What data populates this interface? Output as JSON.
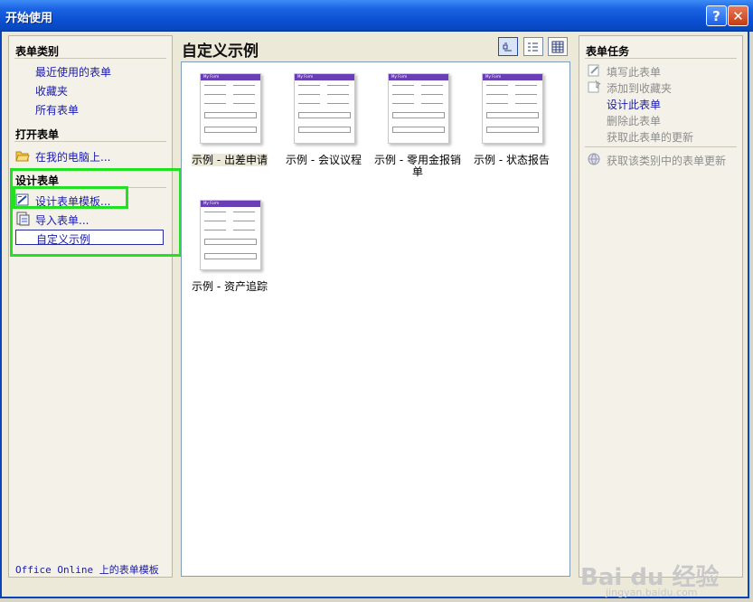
{
  "window": {
    "title": "开始使用",
    "help_label": "?",
    "close_label": "✕"
  },
  "left": {
    "section_categories": "表单类别",
    "categories": [
      {
        "label": "最近使用的表单"
      },
      {
        "label": "收藏夹"
      },
      {
        "label": "所有表单"
      }
    ],
    "section_open": "打开表单",
    "open_on_computer": "在我的电脑上...",
    "section_design": "设计表单",
    "design_template": "设计表单模板...",
    "import_form": "导入表单...",
    "custom_samples": "自定义示例",
    "office_online": "Office Online 上的表单模板"
  },
  "main": {
    "title": "自定义示例",
    "view_buttons": [
      "large-icons",
      "list",
      "details"
    ],
    "samples": [
      {
        "caption": "示例 - 出差申请",
        "selected": true
      },
      {
        "caption": "示例 - 会议议程",
        "selected": false
      },
      {
        "caption": "示例 - 零用金报销单",
        "selected": false
      },
      {
        "caption": "示例 - 状态报告",
        "selected": false
      },
      {
        "caption": "示例 - 资产追踪",
        "selected": false
      }
    ],
    "thumb_header": "My Form"
  },
  "right": {
    "section_tasks": "表单任务",
    "fill_form": "填写此表单",
    "add_favorites": "添加到收藏夹",
    "design_form": "设计此表单",
    "delete_form": "删除此表单",
    "get_updates": "获取此表单的更新",
    "get_category_updates": "获取该类别中的表单更新"
  },
  "watermark": {
    "brand": "Bai du 经验",
    "url": "jingyan.baidu.com"
  },
  "colors": {
    "titlebar": "#0a4fd1",
    "highlight": "#22e022",
    "link": "#1a1aa8",
    "thumb_header": "#6a3fb5"
  }
}
